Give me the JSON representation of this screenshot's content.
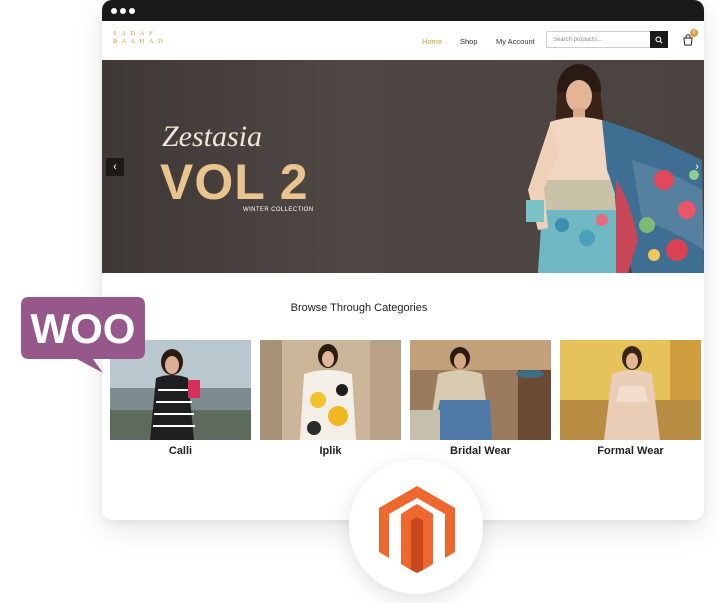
{
  "site": {
    "logo_text": "SADAF RASHAD",
    "nav": [
      "Home",
      "Shop",
      "My Account"
    ],
    "search_placeholder": "Search products...",
    "cart_count": "0"
  },
  "hero": {
    "script_text": "Zestasia",
    "title": "VOL 2",
    "subtitle": "WINTER COLLECTION",
    "prev_arrow": "‹",
    "next_arrow": "›"
  },
  "categories": {
    "title": "Browse Through Categories",
    "items": [
      "Calli",
      "Iplik",
      "Bridal Wear",
      "Formal Wear"
    ]
  },
  "badges": {
    "woo_text": "WOO"
  },
  "colors": {
    "accent_gold": "#d3a03f",
    "titlebar": "#1a1a1a",
    "woo_purple": "#96588a",
    "magento_orange": "#ee672f"
  },
  "icons": [
    "search-icon",
    "cart-icon",
    "chevron-left-icon",
    "chevron-right-icon",
    "woocommerce-logo",
    "magento-logo"
  ]
}
